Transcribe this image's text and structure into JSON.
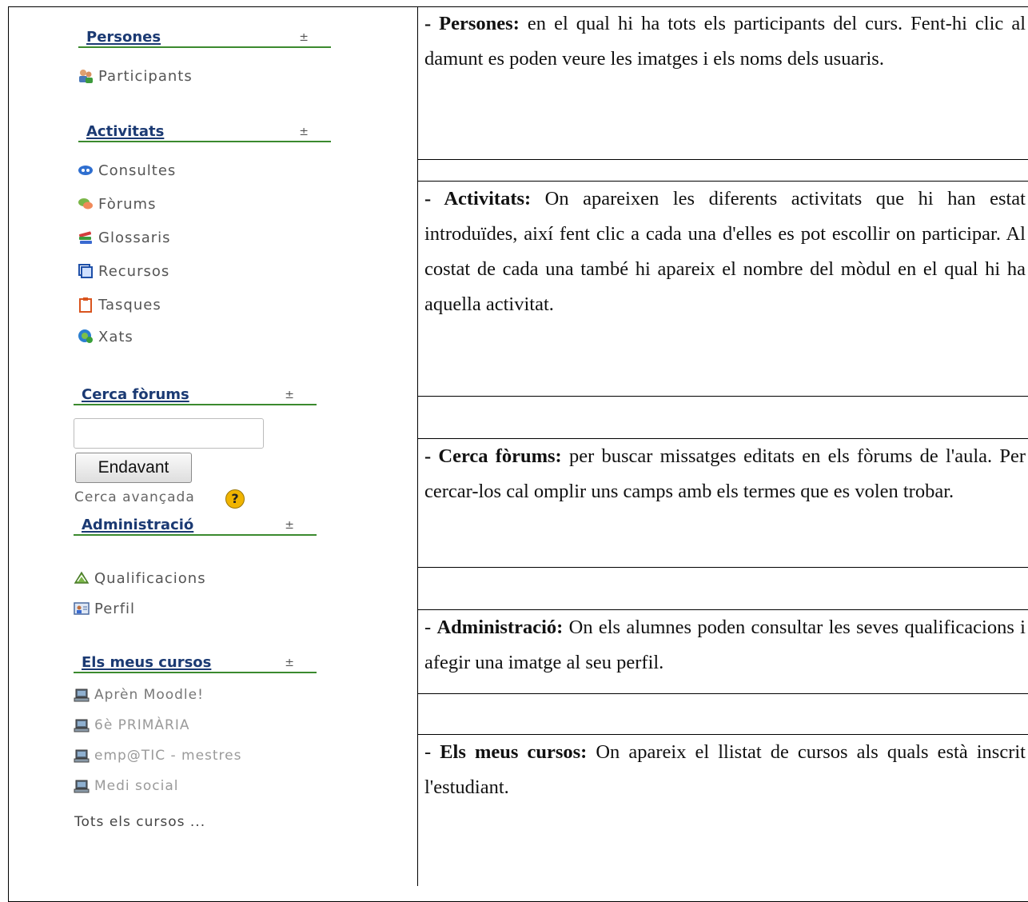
{
  "sidebar": {
    "persones": {
      "title": "Persones",
      "items": [
        {
          "label": "Participants",
          "icon": "participants-icon"
        }
      ]
    },
    "activitats": {
      "title": "Activitats",
      "items": [
        {
          "label": "Consultes",
          "icon": "choice-icon"
        },
        {
          "label": "Fòrums",
          "icon": "forum-icon"
        },
        {
          "label": "Glossaris",
          "icon": "glossary-icon"
        },
        {
          "label": "Recursos",
          "icon": "resource-icon"
        },
        {
          "label": "Tasques",
          "icon": "assignment-icon"
        },
        {
          "label": "Xats",
          "icon": "chat-icon"
        }
      ]
    },
    "cerca": {
      "title": "Cerca fòrums",
      "input_value": "",
      "button_label": "Endavant",
      "advanced_label": "Cerca avançada",
      "help_glyph": "?"
    },
    "administracio": {
      "title": "Administració",
      "items": [
        {
          "label": "Qualificacions",
          "icon": "grades-icon"
        },
        {
          "label": "Perfil",
          "icon": "profile-icon"
        }
      ]
    },
    "cursos": {
      "title": "Els meus cursos",
      "items": [
        {
          "label": "Aprèn Moodle!",
          "icon": "course-icon"
        },
        {
          "label": "6è PRIMÀRIA",
          "icon": "course-icon"
        },
        {
          "label": "emp@TIC - mestres",
          "icon": "course-icon"
        },
        {
          "label": "Medi social",
          "icon": "course-icon"
        }
      ],
      "all_label": "Tots els cursos ..."
    },
    "hide_glyph": "±"
  },
  "descriptions": [
    {
      "term": "- Persones:",
      "text": " en el qual hi ha tots els participants del curs. Fent-hi clic al damunt es poden veure les imatges i els noms dels usuaris."
    },
    {
      "term": "- Activitats:",
      "text": " On apareixen les diferents activitats que hi han estat introduïdes, així fent clic a cada una d'elles es pot escollir on participar. Al costat de cada una també hi apareix el nombre del mòdul en el qual hi ha aquella activitat."
    },
    {
      "term": "- Cerca fòrums:",
      "text": " per buscar missatges editats en els fòrums de l'aula. Per cercar-los cal omplir uns camps amb els termes que es volen trobar."
    },
    {
      "prefix": "- ",
      "term": "Administració:",
      "text": " On els alumnes poden consultar les seves qualificacions i afegir una imatge al seu perfil."
    },
    {
      "prefix": "- ",
      "term": "Els meus cursos:",
      "text": " On apareix el llistat de cursos als quals està inscrit l'estudiant."
    }
  ]
}
